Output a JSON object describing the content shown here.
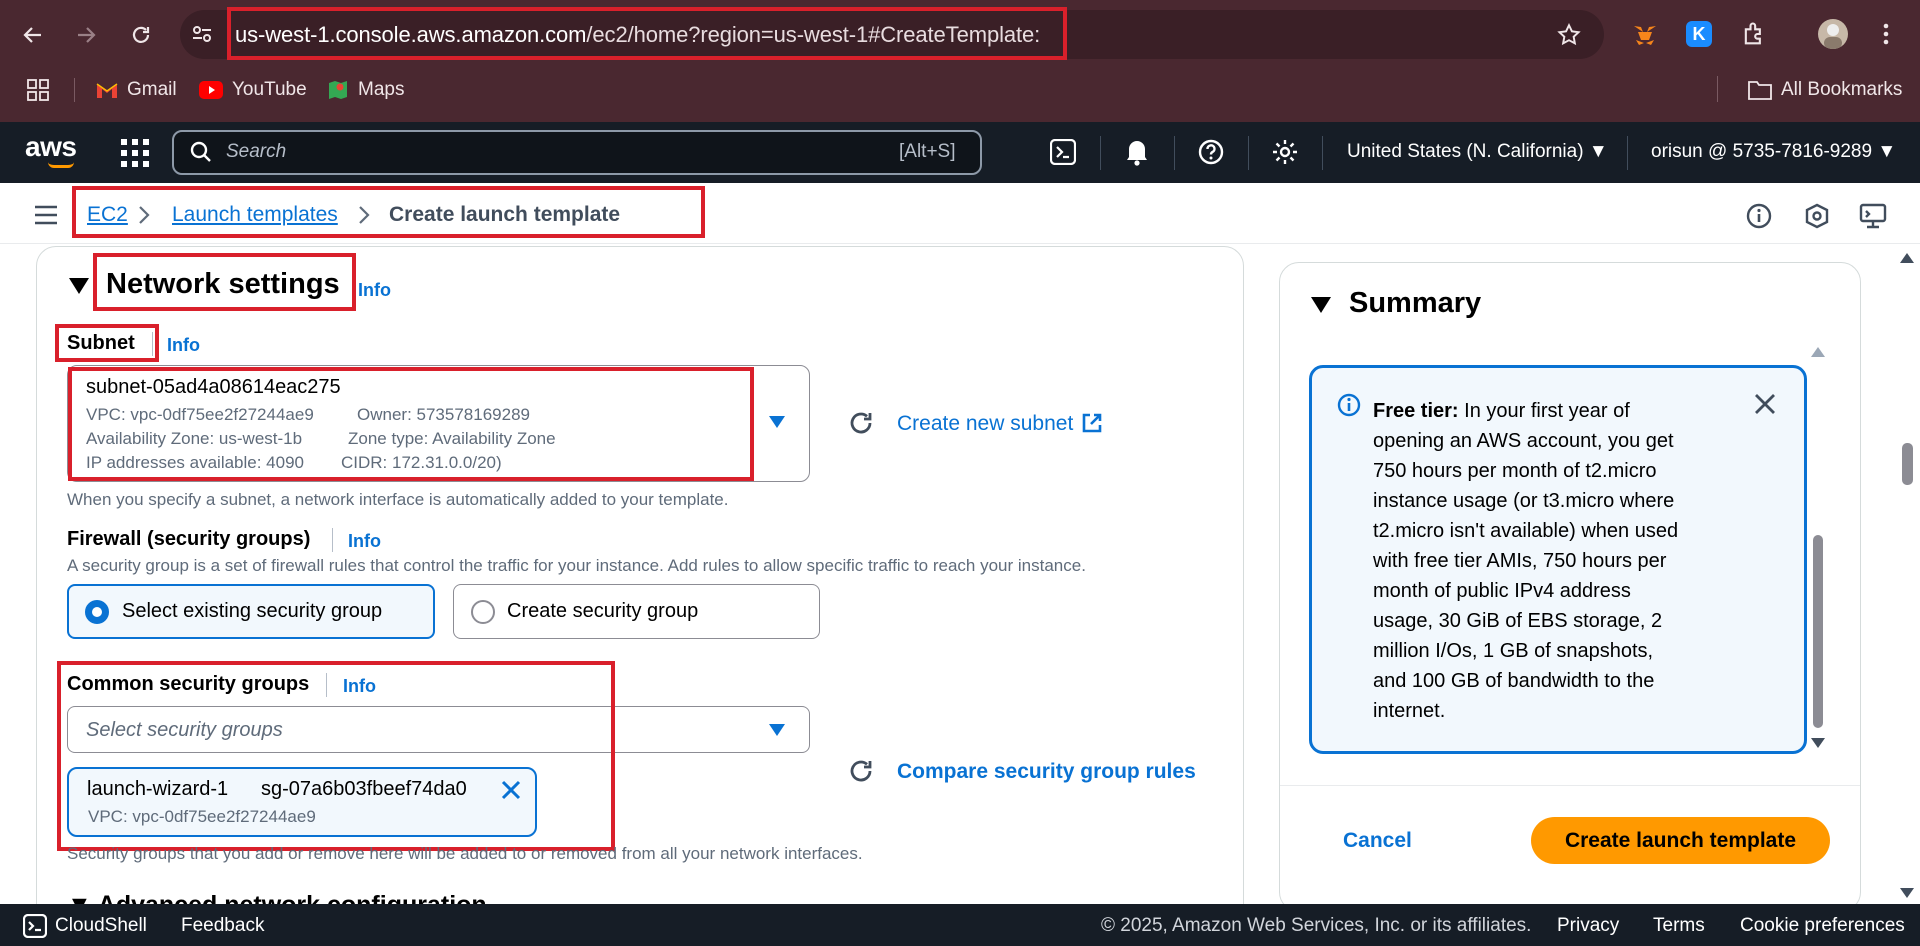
{
  "browser": {
    "url_host": "us-west-1.console.aws.amazon.com",
    "url_path": "/ec2/home?region=us-west-1#CreateTemplate:",
    "bookmarks": [
      "Gmail",
      "YouTube",
      "Maps"
    ],
    "all_bookmarks": "All Bookmarks"
  },
  "aws_nav": {
    "logo": "aws",
    "search_placeholder": "Search",
    "search_shortcut": "[Alt+S]",
    "region": "United States (N. California)",
    "account": "orisun @ 5735-7816-9289"
  },
  "breadcrumb": [
    "EC2",
    "Launch templates",
    "Create launch template"
  ],
  "network": {
    "title": "Network settings",
    "info": "Info",
    "subnet_label": "Subnet",
    "subnet_id": "subnet-05ad4a08614eac275",
    "vpc": "VPC: vpc-0df75ee2f27244ae9",
    "owner": "Owner: 573578169289",
    "az": "Availability Zone: us-west-1b",
    "zone_type": "Zone type: Availability Zone",
    "ips": "IP addresses available: 4090",
    "cidr": "CIDR: 172.31.0.0/20)",
    "create_subnet": "Create new subnet",
    "subnet_help": "When you specify a subnet, a network interface is automatically added to your template.",
    "firewall_label": "Firewall (security groups)",
    "firewall_desc": "A security group is a set of firewall rules that control the traffic for your instance. Add rules to allow specific traffic to reach your instance.",
    "opt_existing": "Select existing security group",
    "opt_create": "Create security group",
    "common_label": "Common security groups",
    "sg_placeholder": "Select security groups",
    "compare_rules": "Compare security group rules",
    "token_name": "launch-wizard-1",
    "token_id": "sg-07a6b03fbeef74da0",
    "token_vpc": "VPC: vpc-0df75ee2f27244ae9",
    "sg_help": "Security groups that you add or remove here will be added to or removed from all your network interfaces.",
    "advanced": "Advanced network configuration"
  },
  "summary": {
    "title": "Summary",
    "free_tier_bold": "Free tier:",
    "free_tier_lines": [
      "In your first year of",
      "opening an AWS account, you get",
      "750 hours per month of t2.micro",
      "instance usage (or t3.micro where",
      "t2.micro isn't available) when used",
      "with free tier AMIs, 750 hours per",
      "month of public IPv4 address",
      "usage, 30 GiB of EBS storage, 2",
      "million I/Os, 1 GB of snapshots,",
      "and 100 GB of bandwidth to the",
      "internet."
    ],
    "cancel": "Cancel",
    "create": "Create launch template"
  },
  "footer": {
    "cloudshell": "CloudShell",
    "feedback": "Feedback",
    "copyright": "© 2025, Amazon Web Services, Inc. or its affiliates.",
    "privacy": "Privacy",
    "terms": "Terms",
    "cookies": "Cookie preferences"
  },
  "colors": {
    "chrome": "#4a2830",
    "aws_nav": "#161d26",
    "link": "#0972d3",
    "primary_button": "#ff9900",
    "annotation": "#d9202b"
  }
}
